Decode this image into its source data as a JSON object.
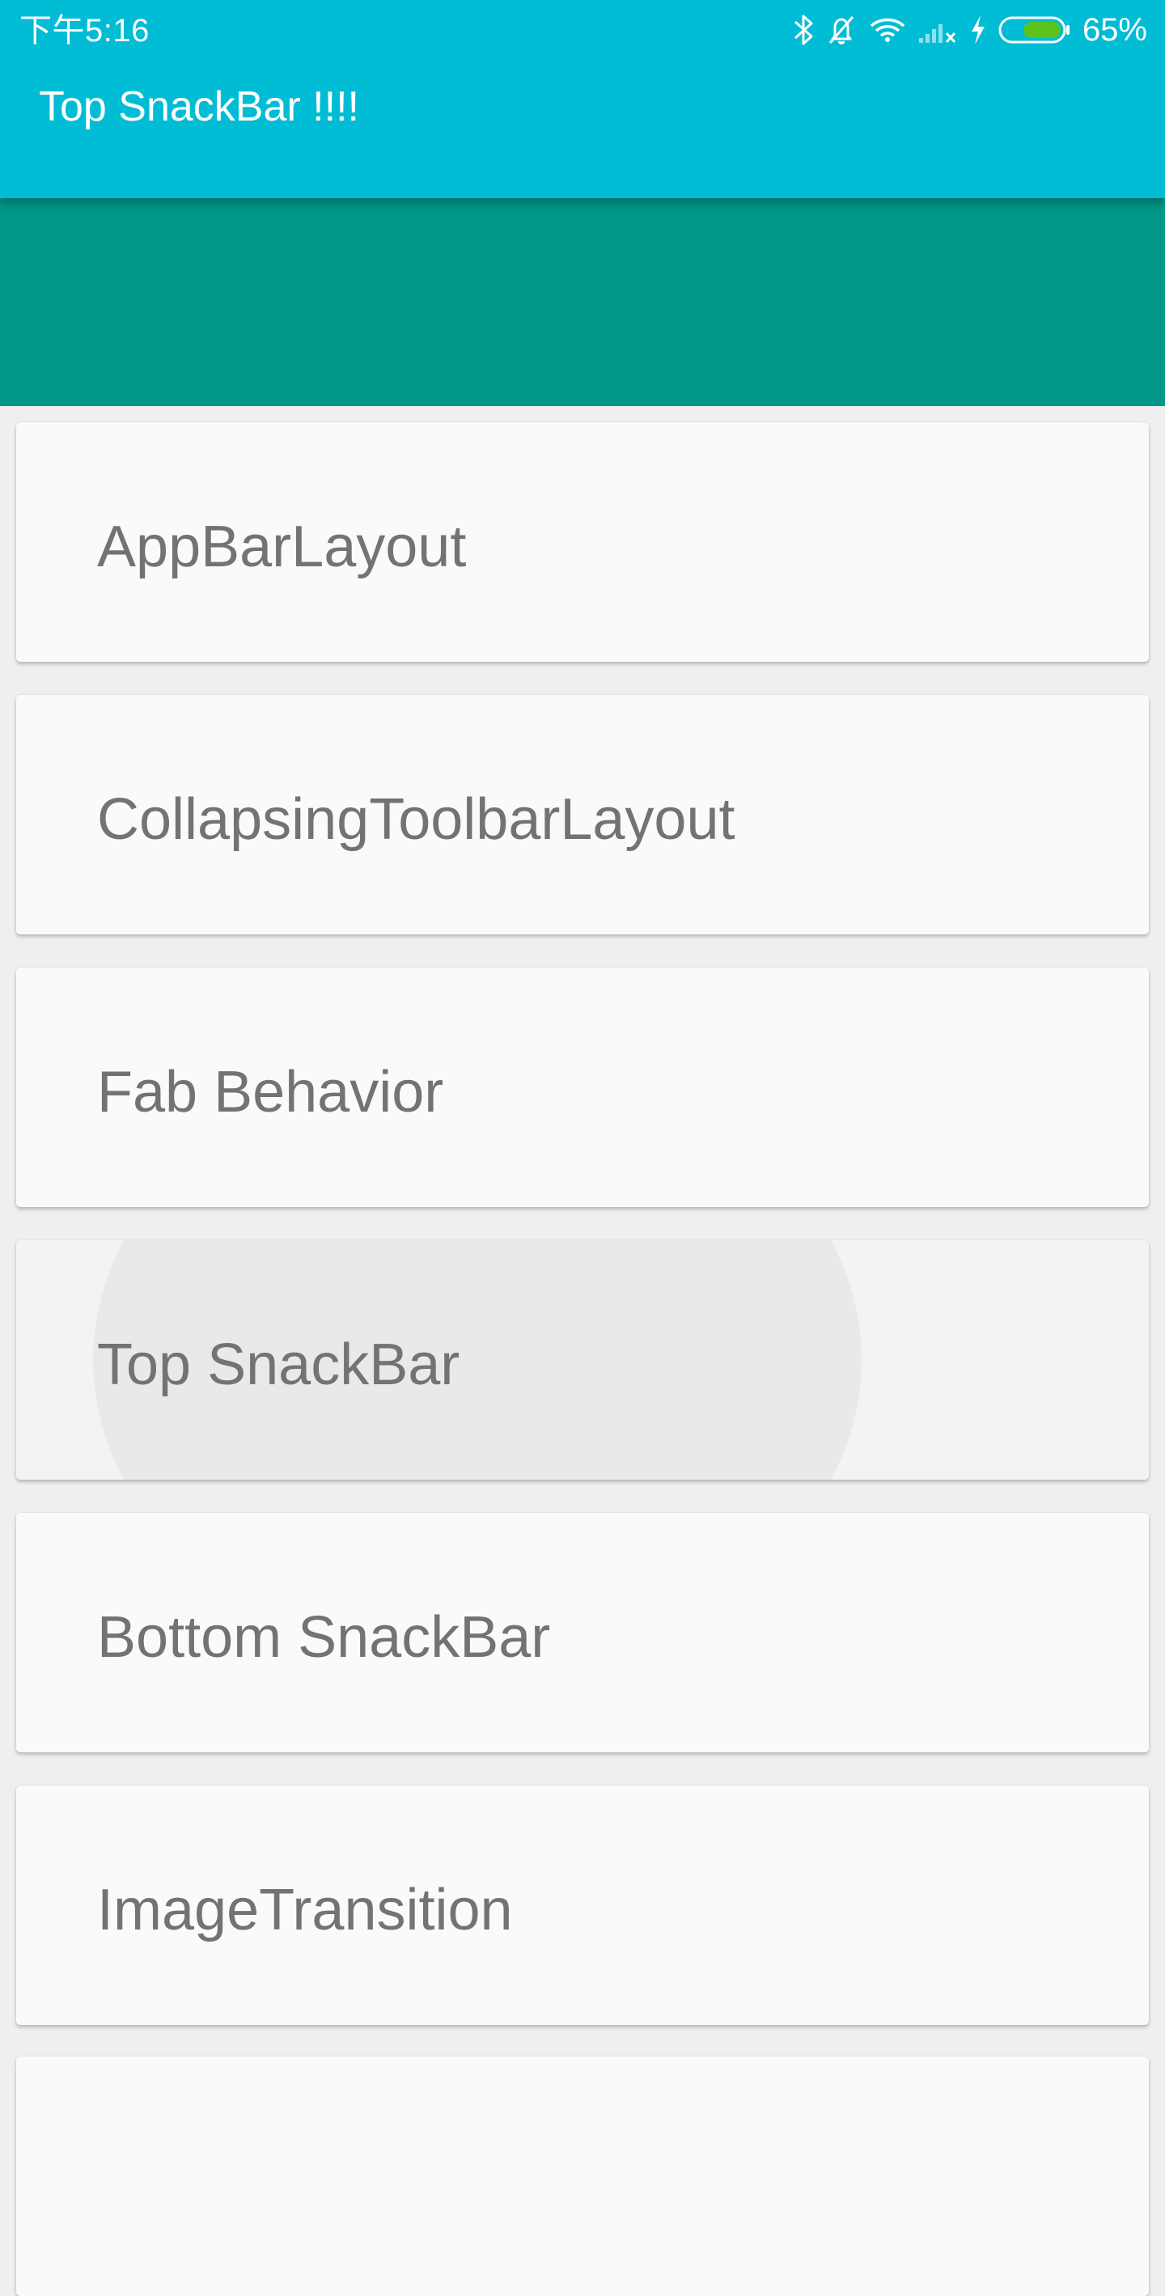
{
  "status_bar": {
    "time": "下午5:16",
    "battery_percent": "65%",
    "icons": [
      "bluetooth-icon",
      "notifications-off-icon",
      "wifi-icon",
      "cell-signal-off-icon",
      "charging-icon",
      "battery-icon"
    ],
    "battery_level": 0.65
  },
  "snackbar": {
    "message": "Top SnackBar !!!!",
    "color": "#00BCD4"
  },
  "app_bar": {
    "color": "#009688"
  },
  "list": {
    "items": [
      {
        "label": "AppBarLayout"
      },
      {
        "label": "CollapsingToolbarLayout"
      },
      {
        "label": "Fab Behavior"
      },
      {
        "label": "Top SnackBar",
        "pressed": true
      },
      {
        "label": "Bottom SnackBar"
      },
      {
        "label": "ImageTransition"
      }
    ]
  },
  "colors": {
    "background": "#efefef",
    "card": "#fafafa",
    "card_text": "#737373"
  }
}
